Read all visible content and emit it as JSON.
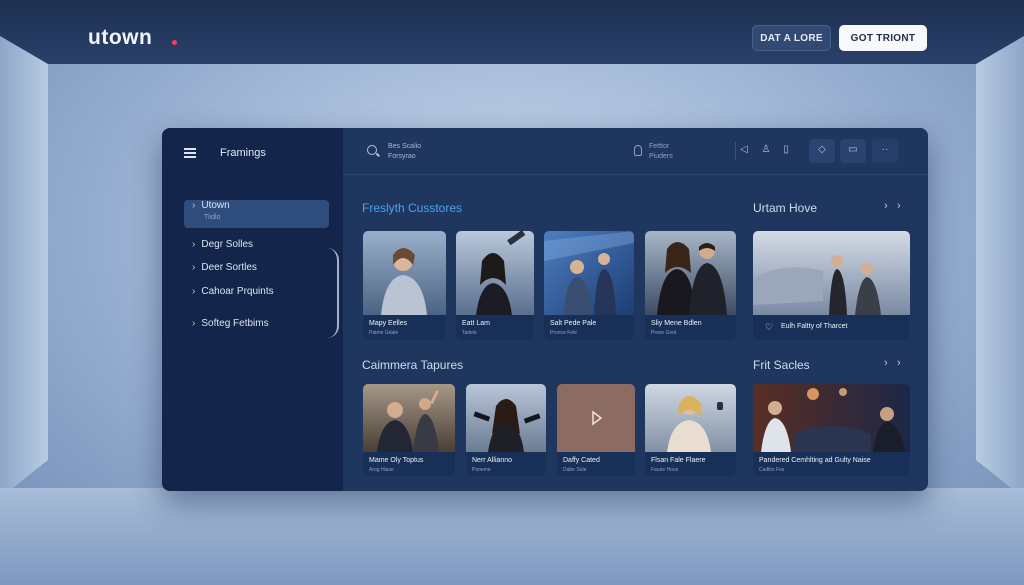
{
  "brand": {
    "logo": "utown"
  },
  "top_buttons": {
    "primary": "DAT A LORE",
    "secondary": "GOT TRIONT"
  },
  "sidebar": {
    "title": "Framings",
    "items": [
      {
        "label": "Utown",
        "sub": "Tiidlo"
      },
      {
        "label": "Degr Solles"
      },
      {
        "label": "Deer Sortles"
      },
      {
        "label": "Cahoar Prquints"
      },
      {
        "label": "Softeg Fetbims"
      }
    ]
  },
  "search": {
    "line1": "Bes Scalio",
    "line2": "Forsyrao"
  },
  "mid_info": {
    "line1": "Fetttor",
    "line2": "Piuders"
  },
  "sections": {
    "freslyth": {
      "title": "Freslyth Cusstores",
      "cards": [
        {
          "title": "Mapy Eelles",
          "sub": "Patme Gdale"
        },
        {
          "title": "Eatt Lam",
          "sub": "Tadele"
        },
        {
          "title": "Salt Pede Pale",
          "sub": "Pronce Fele"
        },
        {
          "title": "Sliy Mene Bdlen",
          "sub": "Prove Goot"
        }
      ]
    },
    "utam": {
      "title": "Urtam Hove",
      "card": {
        "title": "Eulh Faltty of Tharcet"
      }
    },
    "caimmera": {
      "title": "Caimmera Tapures",
      "cards": [
        {
          "title": "Mame Oly Toptus",
          "sub": "Arog Hiase"
        },
        {
          "title": "Nerr Allianno",
          "sub": "Pooeme"
        },
        {
          "title": "Daffy Cated",
          "sub": "Dabe Sole"
        },
        {
          "title": "Flsan Fale Flaere",
          "sub": "Faune Hoos"
        }
      ]
    },
    "frit": {
      "title": "Frit Sacles",
      "card": {
        "title": "Pandered Cemhlting ad Gulty Naise",
        "sub": "Cadibs Fos"
      }
    }
  }
}
